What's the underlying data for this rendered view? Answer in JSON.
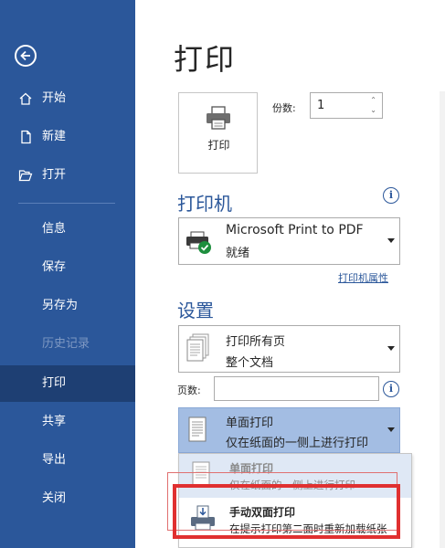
{
  "sidebar": {
    "items": [
      {
        "label": "开始",
        "icon": "home-icon"
      },
      {
        "label": "新建",
        "icon": "new-document-icon"
      },
      {
        "label": "打开",
        "icon": "folder-open-icon"
      },
      {
        "label": "信息"
      },
      {
        "label": "保存"
      },
      {
        "label": "另存为"
      },
      {
        "label": "历史记录",
        "disabled": true
      },
      {
        "label": "打印",
        "active": true
      },
      {
        "label": "共享"
      },
      {
        "label": "导出"
      },
      {
        "label": "关闭"
      }
    ]
  },
  "main": {
    "title": "打印",
    "print_button_label": "打印",
    "copies_label": "份数:",
    "copies_value": "1",
    "printer_section": {
      "heading": "打印机",
      "printer_name": "Microsoft Print to PDF",
      "printer_status": "就绪",
      "properties_link": "打印机属性"
    },
    "settings_section": {
      "heading": "设置",
      "pages_dropdown": {
        "line1": "打印所有页",
        "line2": "整个文档"
      },
      "pages_label": "页数:",
      "pages_value": "",
      "sided_dropdown": {
        "line1": "单面打印",
        "line2": "仅在纸面的一侧上进行打印"
      },
      "sided_menu": [
        {
          "line1": "单面打印",
          "line2": "仅在纸面的一侧上进行打印"
        },
        {
          "line1": "手动双面打印",
          "line2": "在提示打印第二面时重新加载纸张"
        }
      ]
    }
  },
  "colors": {
    "sidebar_bg": "#2b579a",
    "sidebar_active": "#1e3f73",
    "accent": "#2b579a",
    "highlight_red": "#e03030"
  }
}
